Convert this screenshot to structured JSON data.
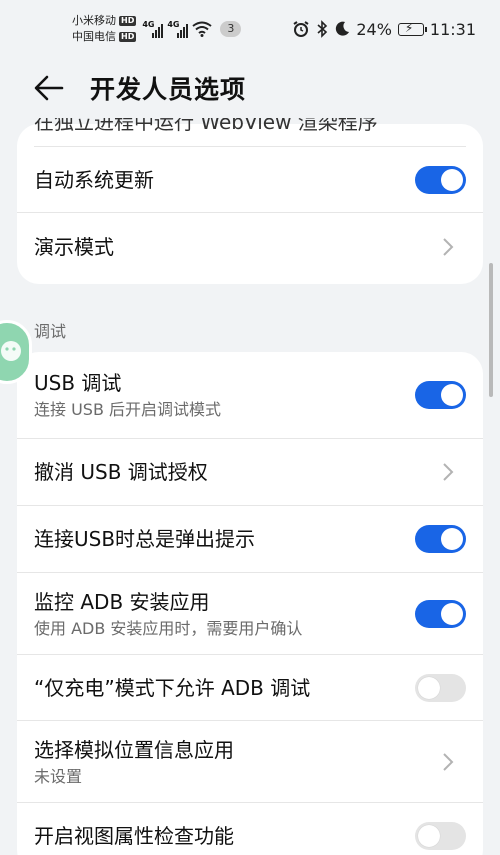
{
  "status": {
    "carrier1": "小米移动",
    "carrier2": "中国电信",
    "hd": "HD",
    "net1": "4G",
    "net2": "4G",
    "notification_count": "3",
    "battery": "24%",
    "time": "11:31",
    "icons": [
      "alarm-icon",
      "bluetooth-icon",
      "moon-icon",
      "battery-charging-icon",
      "wifi-icon"
    ]
  },
  "header": {
    "title": "开发人员选项"
  },
  "top_card": {
    "cut_text": "在独立进程中运行 WebView 渲染程序",
    "rows": [
      {
        "title": "自动系统更新",
        "toggle": "on"
      },
      {
        "title": "演示模式"
      }
    ]
  },
  "section": {
    "label": "调试"
  },
  "debug_card": {
    "rows": [
      {
        "title": "USB 调试",
        "subtitle": "连接 USB 后开启调试模式",
        "toggle": "on"
      },
      {
        "title": "撤消 USB 调试授权"
      },
      {
        "title": "连接USB时总是弹出提示",
        "toggle": "on"
      },
      {
        "title": "监控 ADB 安装应用",
        "subtitle": "使用 ADB 安装应用时，需要用户确认",
        "toggle": "on"
      },
      {
        "title": "“仅充电”模式下允许 ADB 调试",
        "toggle": "off"
      },
      {
        "title": "选择模拟位置信息应用",
        "subtitle": "未设置"
      },
      {
        "title": "开启视图属性检查功能",
        "toggle": "off"
      }
    ]
  },
  "colors": {
    "accent": "#1965e6",
    "background": "#f1f3f5",
    "card": "#ffffff"
  }
}
